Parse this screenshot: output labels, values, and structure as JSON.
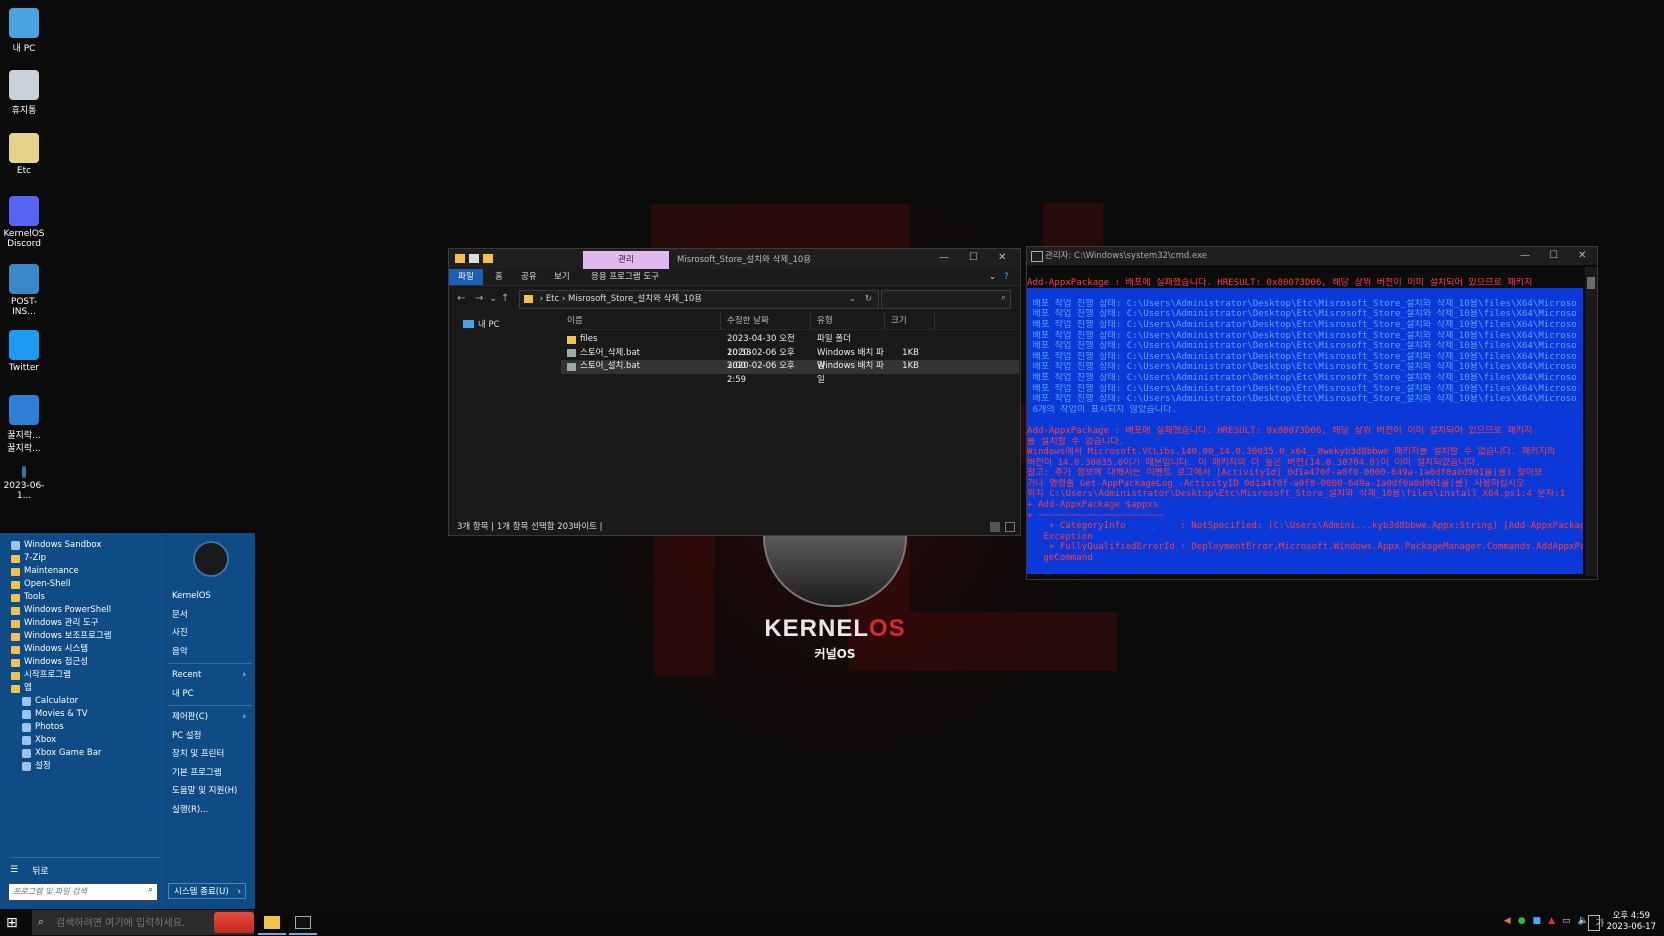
{
  "desktop": {
    "icons": [
      {
        "label": "내 PC",
        "icon": "computer-icon",
        "color": "#4aa3df"
      },
      {
        "label": "휴지통",
        "icon": "recycle-bin-icon",
        "color": "#c9d1d9"
      },
      {
        "label": "Etc",
        "icon": "text-file-icon",
        "color": "#e7d28a"
      },
      {
        "label": "KernelOS\nDiscord",
        "icon": "discord-icon",
        "color": "#5865f2"
      },
      {
        "label": "POST-INS...",
        "icon": "installer-icon",
        "color": "#3a87c8"
      },
      {
        "label": "Twitter",
        "icon": "twitter-icon",
        "color": "#1d9bf0"
      },
      {
        "label": "꿀지락...\n꿀지락...",
        "icon": "internet-explorer-icon",
        "color": "#2f7fd6"
      },
      {
        "label": "2023-06-1...",
        "icon": "file-icon",
        "color": "#3a6ea5"
      }
    ],
    "wallpaper": {
      "brand": "KERNEL",
      "brand_accent": "OS",
      "subtitle": "커널OS"
    }
  },
  "start_menu": {
    "left_items": [
      {
        "label": "Windows Sandbox",
        "type": "app"
      },
      {
        "label": "7-Zip",
        "type": "folder"
      },
      {
        "label": "Maintenance",
        "type": "folder"
      },
      {
        "label": "Open-Shell",
        "type": "folder"
      },
      {
        "label": "Tools",
        "type": "folder"
      },
      {
        "label": "Windows PowerShell",
        "type": "folder"
      },
      {
        "label": "Windows 관리 도구",
        "type": "folder"
      },
      {
        "label": "Windows 보조프로그램",
        "type": "folder"
      },
      {
        "label": "Windows 시스템",
        "type": "folder"
      },
      {
        "label": "Windows 접근성",
        "type": "folder"
      },
      {
        "label": "시작프로그램",
        "type": "folder"
      },
      {
        "label": "앱",
        "type": "folder"
      },
      {
        "label": "Calculator",
        "type": "sub"
      },
      {
        "label": "Movies & TV",
        "type": "sub"
      },
      {
        "label": "Photos",
        "type": "sub"
      },
      {
        "label": "Xbox",
        "type": "sub"
      },
      {
        "label": "Xbox Game Bar",
        "type": "sub"
      },
      {
        "label": "설정",
        "type": "sub"
      }
    ],
    "right_items": [
      {
        "label": "KernelOS",
        "arrow": ""
      },
      {
        "label": "문서",
        "arrow": ""
      },
      {
        "label": "사진",
        "arrow": ""
      },
      {
        "label": "음악",
        "arrow": ""
      },
      {
        "label": "Recent",
        "arrow": "›"
      },
      {
        "label": "내 PC",
        "arrow": ""
      },
      {
        "label": "제어판(C)",
        "arrow": "›"
      },
      {
        "label": "PC 설정",
        "arrow": ""
      },
      {
        "label": "장치 및 프린터",
        "arrow": ""
      },
      {
        "label": "기본 프로그램",
        "arrow": ""
      },
      {
        "label": "도움말 및 지원(H)",
        "arrow": ""
      },
      {
        "label": "실행(R)...",
        "arrow": ""
      }
    ],
    "back_label": "뒤로",
    "search_placeholder": "프로그램 및 파일 검색",
    "shutdown_label": "시스템 종료(U)"
  },
  "taskbar": {
    "search_placeholder": "검색하려면 여기에 입력하세요.",
    "tray_lang": "가",
    "time": "오후 4:59",
    "date": "2023-06-17"
  },
  "explorer": {
    "manage_tab": "관리",
    "title": "Misrosoft_Store_설치와 삭제_10용",
    "ribbon_tabs": [
      "파일",
      "홈",
      "공유",
      "보기",
      "응용 프로그램 도구"
    ],
    "breadcrumb": [
      "Etc",
      "Misrosoft_Store_설치와 삭제_10용"
    ],
    "nav_item": "내 PC",
    "columns": [
      "이름",
      "수정한 날짜",
      "유형",
      "크기"
    ],
    "rows": [
      {
        "name": "files",
        "date": "2023-04-30 오전 10:53",
        "type": "파일 폴더",
        "size": "",
        "kind": "folder"
      },
      {
        "name": "스토어_삭제.bat",
        "date": "2020-02-06 오후 3:00",
        "type": "Windows 배치 파일",
        "size": "1KB",
        "kind": "bat"
      },
      {
        "name": "스토어_설치.bat",
        "date": "2020-02-06 오후 2:59",
        "type": "Windows 배치 파일",
        "size": "1KB",
        "kind": "bat"
      }
    ],
    "status": "3개 항목  |  1개 항목 선택함 203바이트  |"
  },
  "cmd": {
    "title": "관리자: C:\\Windows\\system32\\cmd.exe",
    "lines": [
      {
        "t": "",
        "c": "",
        "h": false
      },
      {
        "t": "Add-AppxPackage : 배포에 실패했습니다. HRESULT: 0x80073D06, 해당 상위 버전이 이미 설치되어 있으므로 패키지",
        "c": "red",
        "h": false
      },
      {
        "t": "",
        "c": "",
        "h": true
      },
      {
        "t": " 배포 작업 진행 상태: C:\\Users\\Administrator\\Desktop\\Etc\\Misrosoft_Store_설치와 삭제_10용\\files\\X64\\Microso",
        "c": "blue",
        "h": true
      },
      {
        "t": " 배포 작업 진행 상태: C:\\Users\\Administrator\\Desktop\\Etc\\Misrosoft_Store_설치와 삭제_10용\\files\\X64\\Microso",
        "c": "blue",
        "h": true
      },
      {
        "t": " 배포 작업 진행 상태: C:\\Users\\Administrator\\Desktop\\Etc\\Misrosoft_Store_설치와 삭제_10용\\files\\X64\\Microso",
        "c": "blue",
        "h": true
      },
      {
        "t": " 배포 작업 진행 상태: C:\\Users\\Administrator\\Desktop\\Etc\\Misrosoft_Store_설치와 삭제_10용\\files\\X64\\Microso",
        "c": "blue",
        "h": true
      },
      {
        "t": " 배포 작업 진행 상태: C:\\Users\\Administrator\\Desktop\\Etc\\Misrosoft_Store_설치와 삭제_10용\\files\\X64\\Microso",
        "c": "blue",
        "h": true
      },
      {
        "t": " 배포 작업 진행 상태: C:\\Users\\Administrator\\Desktop\\Etc\\Misrosoft_Store_설치와 삭제_10용\\files\\X64\\Microso",
        "c": "blue",
        "h": true
      },
      {
        "t": " 배포 작업 진행 상태: C:\\Users\\Administrator\\Desktop\\Etc\\Misrosoft_Store_설치와 삭제_10용\\files\\X64\\Microso",
        "c": "blue",
        "h": true
      },
      {
        "t": " 배포 작업 진행 상태: C:\\Users\\Administrator\\Desktop\\Etc\\Misrosoft_Store_설치와 삭제_10용\\files\\X64\\Microso",
        "c": "blue",
        "h": true
      },
      {
        "t": " 배포 작업 진행 상태: C:\\Users\\Administrator\\Desktop\\Etc\\Misrosoft_Store_설치와 삭제_10용\\files\\X64\\Microso",
        "c": "blue",
        "h": true
      },
      {
        "t": " 배포 작업 진행 상태: C:\\Users\\Administrator\\Desktop\\Etc\\Misrosoft_Store_설치와 삭제_10용\\files\\X64\\Microso",
        "c": "blue",
        "h": true
      },
      {
        "t": " 6개의 작업이 표시되지 않았습니다.",
        "c": "blue",
        "h": true
      },
      {
        "t": "",
        "c": "",
        "h": true
      },
      {
        "t": "Add-AppxPackage : 배포에 실패했습니다. HRESULT: 0x80073D06, 해당 상위 버전이 이미 설치되어 있으므로 패키지",
        "c": "red",
        "h": true
      },
      {
        "t": "를 설치할 수 없습니다.",
        "c": "red",
        "h": true
      },
      {
        "t": "Windows에서 Microsoft.VCLibs.140.00_14.0.30035.0_x64__8wekyb3d8bbwe 패키지를 설치할 수 없습니다. 패키지의",
        "c": "red",
        "h": true
      },
      {
        "t": "버전이 14.0.30035.0이기 때문입니다. 이 패키지의 더 높은 버전(14.0.30704.0)이 이미 설치되었습니다.",
        "c": "red",
        "h": true
      },
      {
        "t": "참고: 추가 정보에 대해서는 이벤트 로그에서 [ActivityId] 0d1a470f-a0f0-0000-649a-1a0df0a0d901을(를) 찾아보",
        "c": "red",
        "h": true
      },
      {
        "t": "거나 명령줄 Get-AppPackageLog -ActivityID 0d1a470f-a0f0-0000-649a-1a0df0a0d901을(를) 사용하십시오",
        "c": "red",
        "h": true
      },
      {
        "t": "위치 C:\\Users\\Administrator\\Desktop\\Etc\\Misrosoft_Store_설치와 삭제_10용\\files\\install_X64.ps1:4 문자:1",
        "c": "red",
        "h": true
      },
      {
        "t": "+ Add-AppxPackage $appxs",
        "c": "red",
        "h": true
      },
      {
        "t": "+ ~~~~~~~~~~~~~~~~~~~~~~~",
        "c": "red",
        "h": true
      },
      {
        "t": "    + CategoryInfo          : NotSpecified: (C:\\Users\\Admini...kyb3d8bbwe.Appx:String) [Add-AppxPackage],",
        "c": "red",
        "h": true
      },
      {
        "t": "   Exception",
        "c": "red",
        "h": true
      },
      {
        "t": "    + FullyQualifiedErrorId : DeploymentError,Microsoft.Windows.Appx.PackageManager.Commands.AddAppxPacka",
        "c": "red",
        "h": true
      },
      {
        "t": "   geCommand",
        "c": "red",
        "h": true
      },
      {
        "t": "",
        "c": "",
        "h": true
      },
      {
        "t": "_",
        "c": "",
        "h": false
      }
    ]
  },
  "colors": {
    "start_bg": "#0f4c86",
    "cmd_highlight": "#0a39d8",
    "cmd_error": "#ff3b3b",
    "explorer_file_tab": "#1a5fb4",
    "manage_tab": "#e2b8f0"
  }
}
